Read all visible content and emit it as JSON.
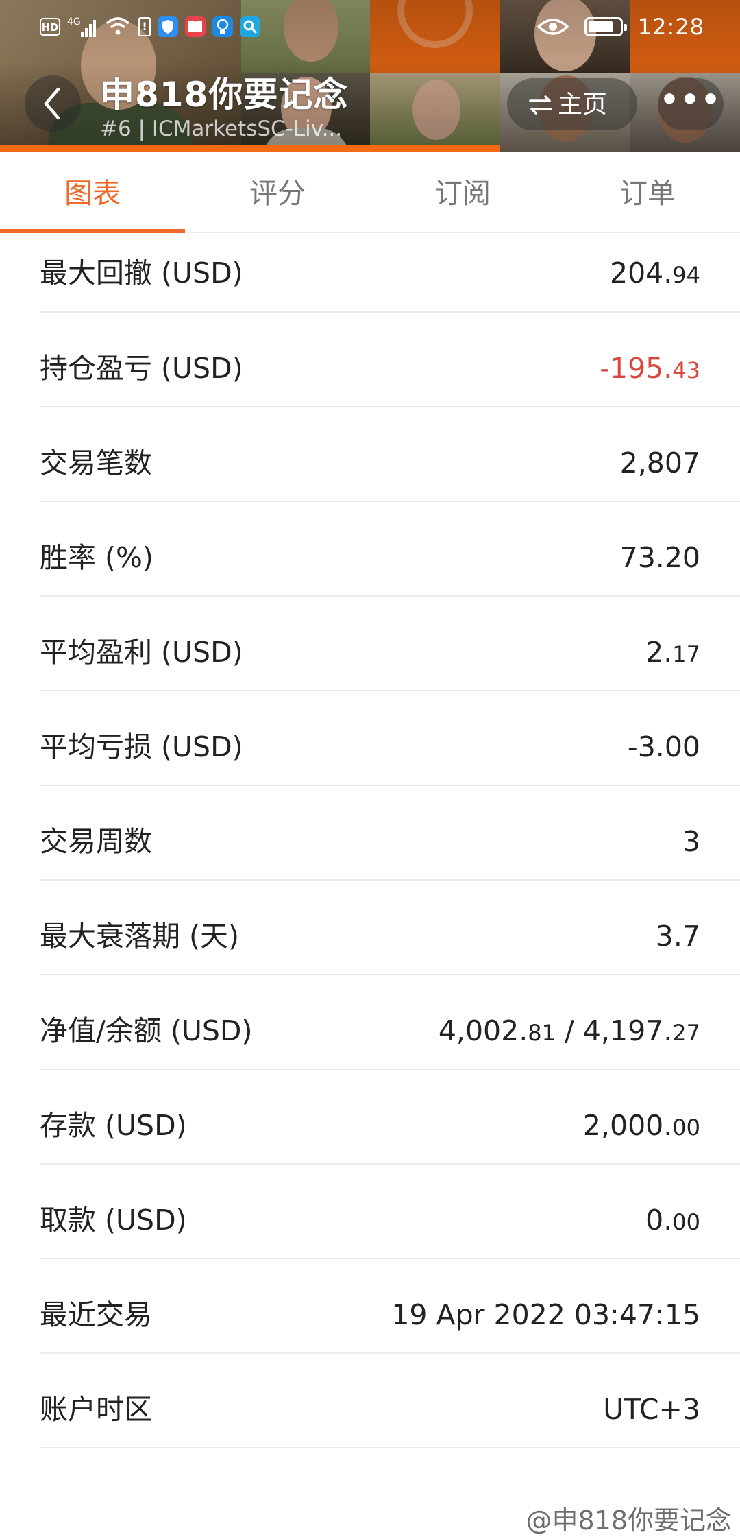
{
  "status_bar": {
    "hd": "HD",
    "signal": "4G",
    "time": "12:28",
    "battery_level": 0.8
  },
  "header": {
    "title": "申818你要记念",
    "subtitle": "#6  |  ICMarketsSC-Liv...",
    "home_label": "主页",
    "more_label": "•••"
  },
  "tabs": [
    {
      "label": "图表",
      "active": true
    },
    {
      "label": "评分",
      "active": false
    },
    {
      "label": "订阅",
      "active": false
    },
    {
      "label": "订单",
      "active": false
    }
  ],
  "stats": [
    {
      "label": "最大回撤 (USD)",
      "int": "204.",
      "dec": "94",
      "negative": false
    },
    {
      "label": "持仓盈亏 (USD)",
      "int": "-195.",
      "dec": "43",
      "negative": true
    },
    {
      "label": "交易笔数",
      "int": "2,807",
      "dec": "",
      "negative": false
    },
    {
      "label": "胜率 (%)",
      "int": "73.20",
      "dec": "",
      "negative": false
    },
    {
      "label": "平均盈利 (USD)",
      "int": "2.",
      "dec": "17",
      "negative": false
    },
    {
      "label": "平均亏损 (USD)",
      "int": "-3.00",
      "dec": "",
      "negative": false
    },
    {
      "label": "交易周数",
      "int": "3",
      "dec": "",
      "negative": false
    },
    {
      "label": "最大衰落期 (天)",
      "int": "3.7",
      "dec": "",
      "negative": false
    },
    {
      "label": "净值/余额 (USD)",
      "int": "4,002.",
      "dec": "81",
      "int2": " / 4,197.",
      "dec2": "27",
      "negative": false
    },
    {
      "label": "存款 (USD)",
      "int": "2,000.",
      "dec": "00",
      "negative": false
    },
    {
      "label": "取款 (USD)",
      "int": "0.",
      "dec": "00",
      "negative": false
    },
    {
      "label": "最近交易",
      "int": "19 Apr 2022 03:47:15",
      "dec": "",
      "negative": false
    },
    {
      "label": "账户时区",
      "int": "UTC+3",
      "dec": "",
      "negative": false
    }
  ],
  "watermark": "@申818你要记念",
  "colors": {
    "accent": "#f0692a",
    "negative": "#d9473f",
    "header_orange": "#f36a12"
  }
}
